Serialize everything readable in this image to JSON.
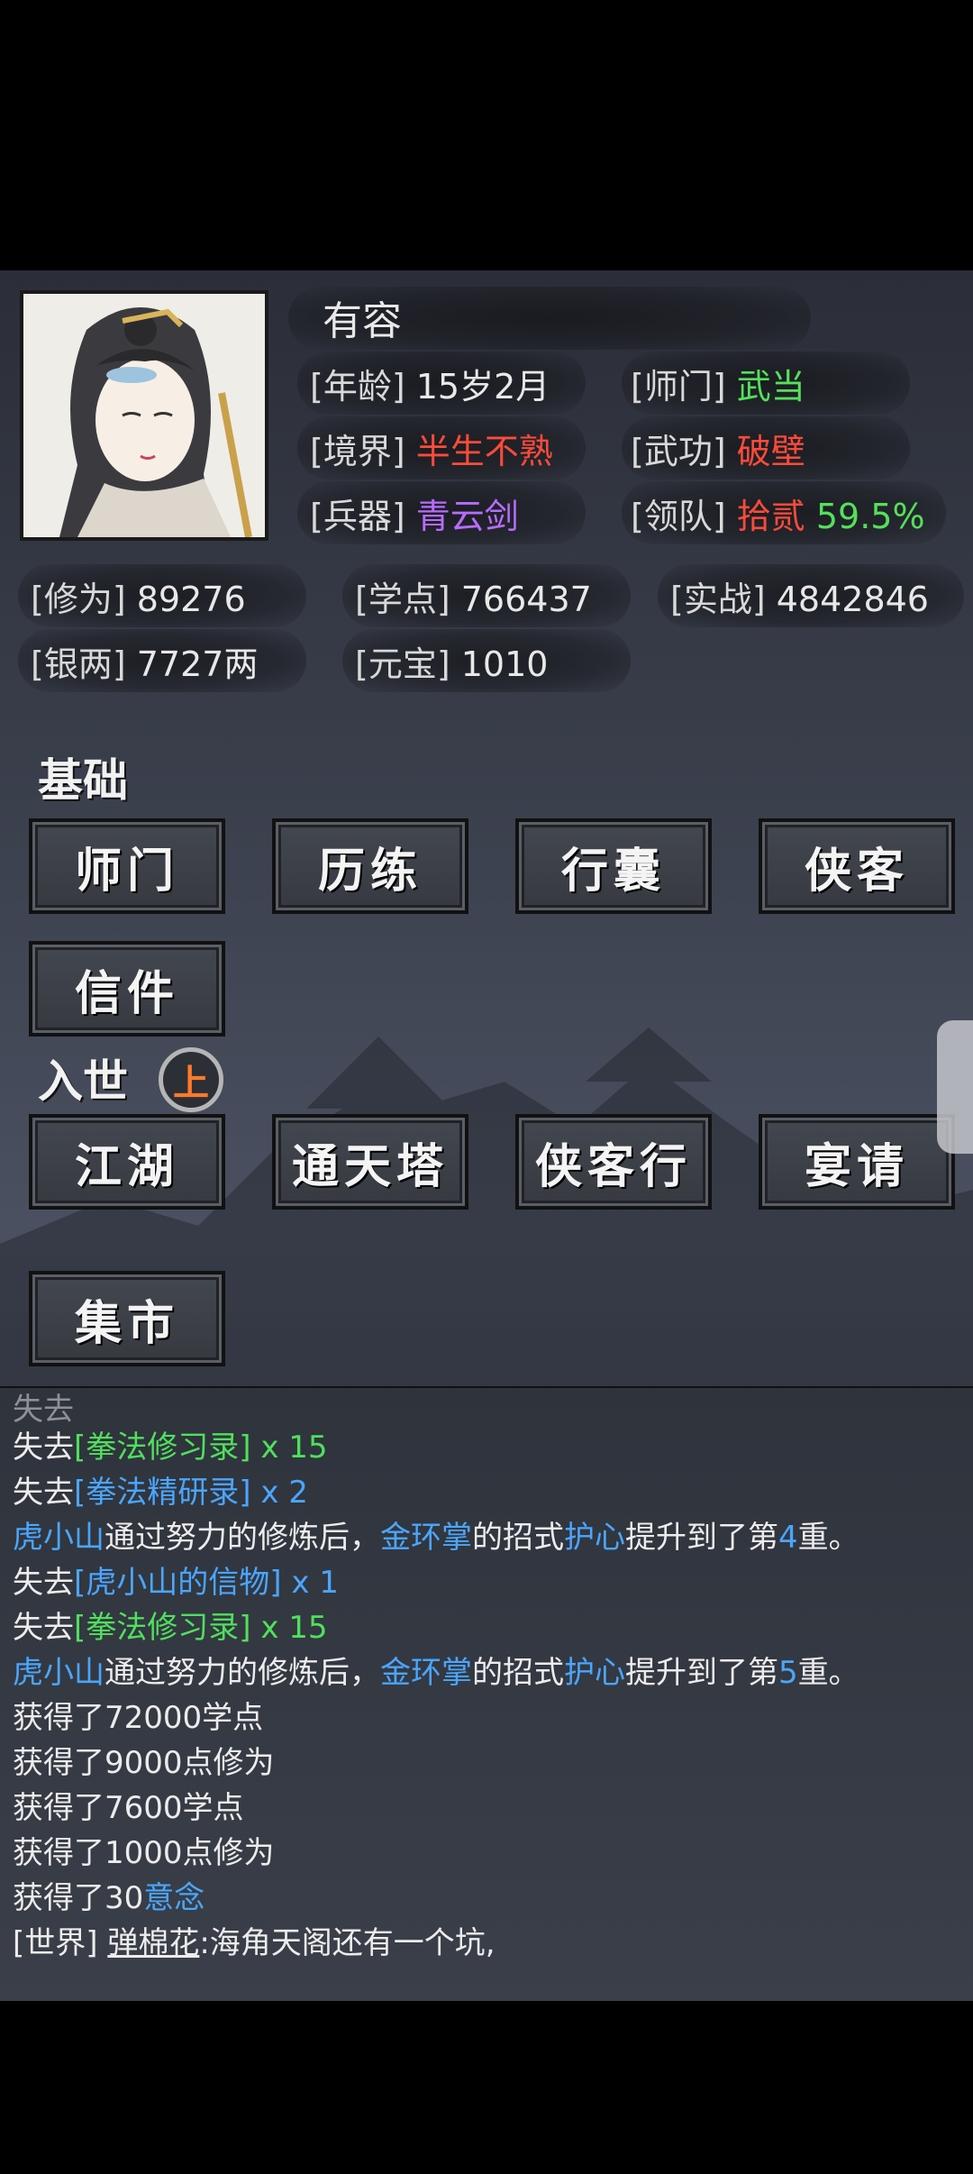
{
  "character": {
    "name": "有容",
    "age_label": "[年龄]",
    "age": "15岁2月",
    "sect_label": "[师门]",
    "sect": "武当",
    "realm_label": "[境界]",
    "realm": "半生不熟",
    "martial_label": "[武功]",
    "martial": "破壁",
    "weapon_label": "[兵器]",
    "weapon": "青云剑",
    "team_label": "[领队]",
    "team": "拾贰",
    "team_pct": "59.5%"
  },
  "stats": {
    "cultivation_label": "[修为]",
    "cultivation": "89276",
    "study_label": "[学点]",
    "study": "766437",
    "combat_label": "[实战]",
    "combat": "4842846",
    "silver_label": "[银两]",
    "silver": "7727两",
    "gold_label": "[元宝]",
    "gold": "1010"
  },
  "sections": {
    "basic": "基础",
    "world": "入世",
    "world_badge": "上"
  },
  "buttons": {
    "sect": "师门",
    "training": "历练",
    "bag": "行囊",
    "hero": "侠客",
    "mail": "信件",
    "jianghu": "江湖",
    "tower": "通天塔",
    "heroway": "侠客行",
    "banquet": "宴请",
    "market": "集市"
  },
  "log": {
    "l1": {
      "a": "失去",
      "item": "[拳法修习录]",
      "n": " x 15"
    },
    "l2": {
      "a": "失去",
      "item": "[拳法精研录]",
      "n": " x 2"
    },
    "l3": {
      "who": "虎小山",
      "mid": "通过努力的修炼后，",
      "skill": "金环掌",
      "mid2": "的招式",
      "move": "护心",
      "end1": "提升到了第",
      "num": "4",
      "end2": "重。"
    },
    "l4": {
      "a": "失去",
      "item": "[虎小山的信物]",
      "n": " x 1"
    },
    "l5": {
      "a": "失去",
      "item": "[拳法修习录]",
      "n": " x 15"
    },
    "l6": {
      "who": "虎小山",
      "mid": "通过努力的修炼后，",
      "skill": "金环掌",
      "mid2": "的招式",
      "move": "护心",
      "end1": "提升到了第",
      "num": "5",
      "end2": "重。"
    },
    "l7": "获得了72000学点",
    "l8": "获得了9000点修为",
    "l9": "获得了7600学点",
    "l10": "获得了1000点修为",
    "l11": {
      "a": "获得了30",
      "b": "意念"
    },
    "l12": {
      "tag": "[世界] ",
      "who": "弹棉花",
      "msg": ":海角天阁还有一个坑,"
    }
  }
}
